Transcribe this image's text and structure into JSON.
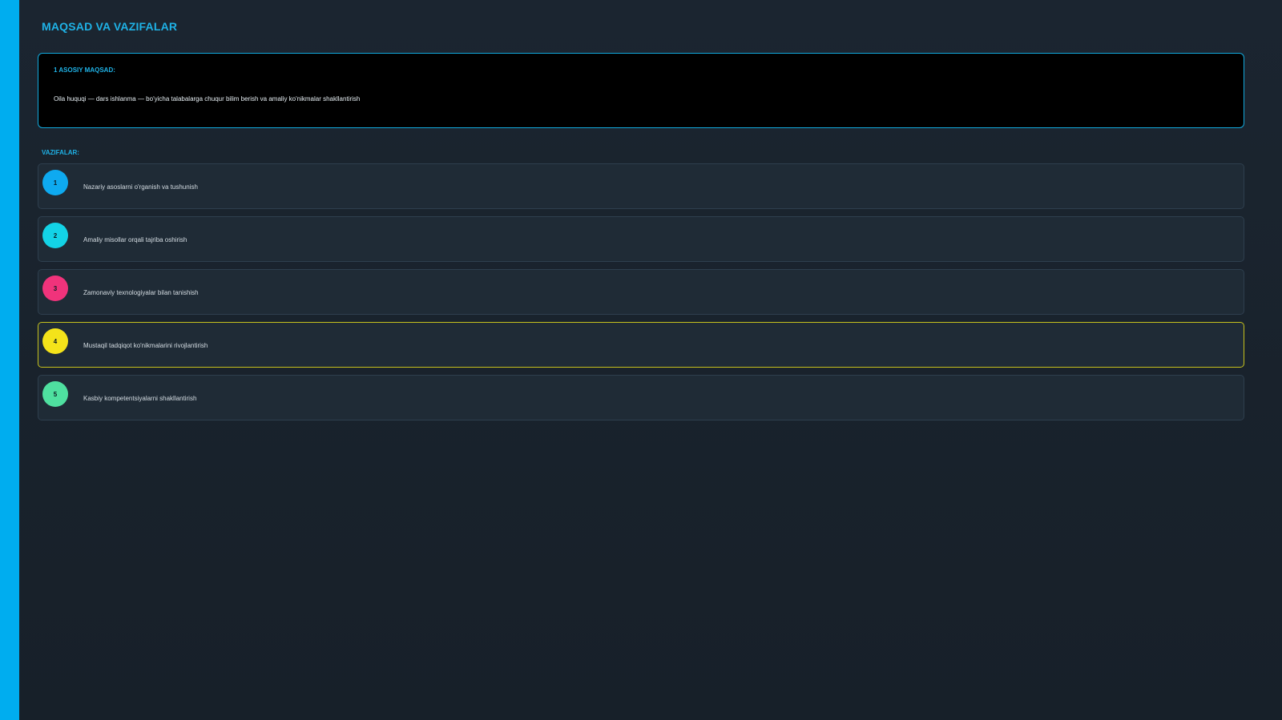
{
  "page": {
    "title": "MAQSAD VA VAZIFALAR"
  },
  "goal": {
    "label": "1 ASOSIY MAQSAD:",
    "text": "Oila huquqi — dars ishlanma — bo'yicha talabalarga chuqur bilim berish va amaliy ko'nikmalar shakllantirish"
  },
  "tasks_label": "VAZIFALAR:",
  "tasks": [
    {
      "number": "1",
      "text": "Nazariy asoslarni o'rganish va tushunish",
      "color": "#0eaaf0"
    },
    {
      "number": "2",
      "text": "Amaliy misollar orqali tajriba oshirish",
      "color": "#13d3e6"
    },
    {
      "number": "3",
      "text": "Zamonaviy texnologiyalar bilan tanishish",
      "color": "#f0337b"
    },
    {
      "number": "4",
      "text": "Mustaqil tadqiqot ko'nikmalarini rivojlantirish",
      "color": "#f4e31a"
    },
    {
      "number": "5",
      "text": "Kasbiy kompetentsiyalarni shakllantirish",
      "color": "#4fe0a0"
    }
  ],
  "theme": {
    "accent": "#00adef",
    "background": "#18212a",
    "card_border": "#2e3f4e",
    "highlight_border": "#c7c21d"
  }
}
